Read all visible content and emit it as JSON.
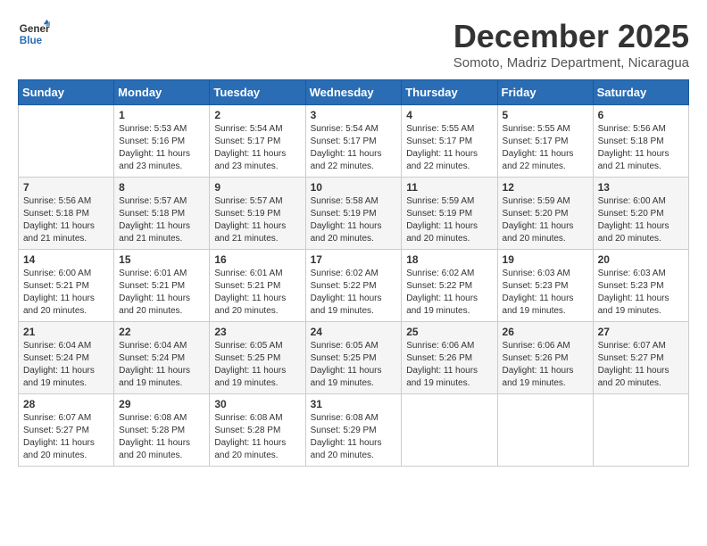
{
  "logo": {
    "general": "General",
    "blue": "Blue"
  },
  "title": "December 2025",
  "location": "Somoto, Madriz Department, Nicaragua",
  "headers": [
    "Sunday",
    "Monday",
    "Tuesday",
    "Wednesday",
    "Thursday",
    "Friday",
    "Saturday"
  ],
  "weeks": [
    [
      {
        "day": "",
        "info": ""
      },
      {
        "day": "1",
        "info": "Sunrise: 5:53 AM\nSunset: 5:16 PM\nDaylight: 11 hours\nand 23 minutes."
      },
      {
        "day": "2",
        "info": "Sunrise: 5:54 AM\nSunset: 5:17 PM\nDaylight: 11 hours\nand 23 minutes."
      },
      {
        "day": "3",
        "info": "Sunrise: 5:54 AM\nSunset: 5:17 PM\nDaylight: 11 hours\nand 22 minutes."
      },
      {
        "day": "4",
        "info": "Sunrise: 5:55 AM\nSunset: 5:17 PM\nDaylight: 11 hours\nand 22 minutes."
      },
      {
        "day": "5",
        "info": "Sunrise: 5:55 AM\nSunset: 5:17 PM\nDaylight: 11 hours\nand 22 minutes."
      },
      {
        "day": "6",
        "info": "Sunrise: 5:56 AM\nSunset: 5:18 PM\nDaylight: 11 hours\nand 21 minutes."
      }
    ],
    [
      {
        "day": "7",
        "info": "Sunrise: 5:56 AM\nSunset: 5:18 PM\nDaylight: 11 hours\nand 21 minutes."
      },
      {
        "day": "8",
        "info": "Sunrise: 5:57 AM\nSunset: 5:18 PM\nDaylight: 11 hours\nand 21 minutes."
      },
      {
        "day": "9",
        "info": "Sunrise: 5:57 AM\nSunset: 5:19 PM\nDaylight: 11 hours\nand 21 minutes."
      },
      {
        "day": "10",
        "info": "Sunrise: 5:58 AM\nSunset: 5:19 PM\nDaylight: 11 hours\nand 20 minutes."
      },
      {
        "day": "11",
        "info": "Sunrise: 5:59 AM\nSunset: 5:19 PM\nDaylight: 11 hours\nand 20 minutes."
      },
      {
        "day": "12",
        "info": "Sunrise: 5:59 AM\nSunset: 5:20 PM\nDaylight: 11 hours\nand 20 minutes."
      },
      {
        "day": "13",
        "info": "Sunrise: 6:00 AM\nSunset: 5:20 PM\nDaylight: 11 hours\nand 20 minutes."
      }
    ],
    [
      {
        "day": "14",
        "info": "Sunrise: 6:00 AM\nSunset: 5:21 PM\nDaylight: 11 hours\nand 20 minutes."
      },
      {
        "day": "15",
        "info": "Sunrise: 6:01 AM\nSunset: 5:21 PM\nDaylight: 11 hours\nand 20 minutes."
      },
      {
        "day": "16",
        "info": "Sunrise: 6:01 AM\nSunset: 5:21 PM\nDaylight: 11 hours\nand 20 minutes."
      },
      {
        "day": "17",
        "info": "Sunrise: 6:02 AM\nSunset: 5:22 PM\nDaylight: 11 hours\nand 19 minutes."
      },
      {
        "day": "18",
        "info": "Sunrise: 6:02 AM\nSunset: 5:22 PM\nDaylight: 11 hours\nand 19 minutes."
      },
      {
        "day": "19",
        "info": "Sunrise: 6:03 AM\nSunset: 5:23 PM\nDaylight: 11 hours\nand 19 minutes."
      },
      {
        "day": "20",
        "info": "Sunrise: 6:03 AM\nSunset: 5:23 PM\nDaylight: 11 hours\nand 19 minutes."
      }
    ],
    [
      {
        "day": "21",
        "info": "Sunrise: 6:04 AM\nSunset: 5:24 PM\nDaylight: 11 hours\nand 19 minutes."
      },
      {
        "day": "22",
        "info": "Sunrise: 6:04 AM\nSunset: 5:24 PM\nDaylight: 11 hours\nand 19 minutes."
      },
      {
        "day": "23",
        "info": "Sunrise: 6:05 AM\nSunset: 5:25 PM\nDaylight: 11 hours\nand 19 minutes."
      },
      {
        "day": "24",
        "info": "Sunrise: 6:05 AM\nSunset: 5:25 PM\nDaylight: 11 hours\nand 19 minutes."
      },
      {
        "day": "25",
        "info": "Sunrise: 6:06 AM\nSunset: 5:26 PM\nDaylight: 11 hours\nand 19 minutes."
      },
      {
        "day": "26",
        "info": "Sunrise: 6:06 AM\nSunset: 5:26 PM\nDaylight: 11 hours\nand 19 minutes."
      },
      {
        "day": "27",
        "info": "Sunrise: 6:07 AM\nSunset: 5:27 PM\nDaylight: 11 hours\nand 20 minutes."
      }
    ],
    [
      {
        "day": "28",
        "info": "Sunrise: 6:07 AM\nSunset: 5:27 PM\nDaylight: 11 hours\nand 20 minutes."
      },
      {
        "day": "29",
        "info": "Sunrise: 6:08 AM\nSunset: 5:28 PM\nDaylight: 11 hours\nand 20 minutes."
      },
      {
        "day": "30",
        "info": "Sunrise: 6:08 AM\nSunset: 5:28 PM\nDaylight: 11 hours\nand 20 minutes."
      },
      {
        "day": "31",
        "info": "Sunrise: 6:08 AM\nSunset: 5:29 PM\nDaylight: 11 hours\nand 20 minutes."
      },
      {
        "day": "",
        "info": ""
      },
      {
        "day": "",
        "info": ""
      },
      {
        "day": "",
        "info": ""
      }
    ]
  ]
}
